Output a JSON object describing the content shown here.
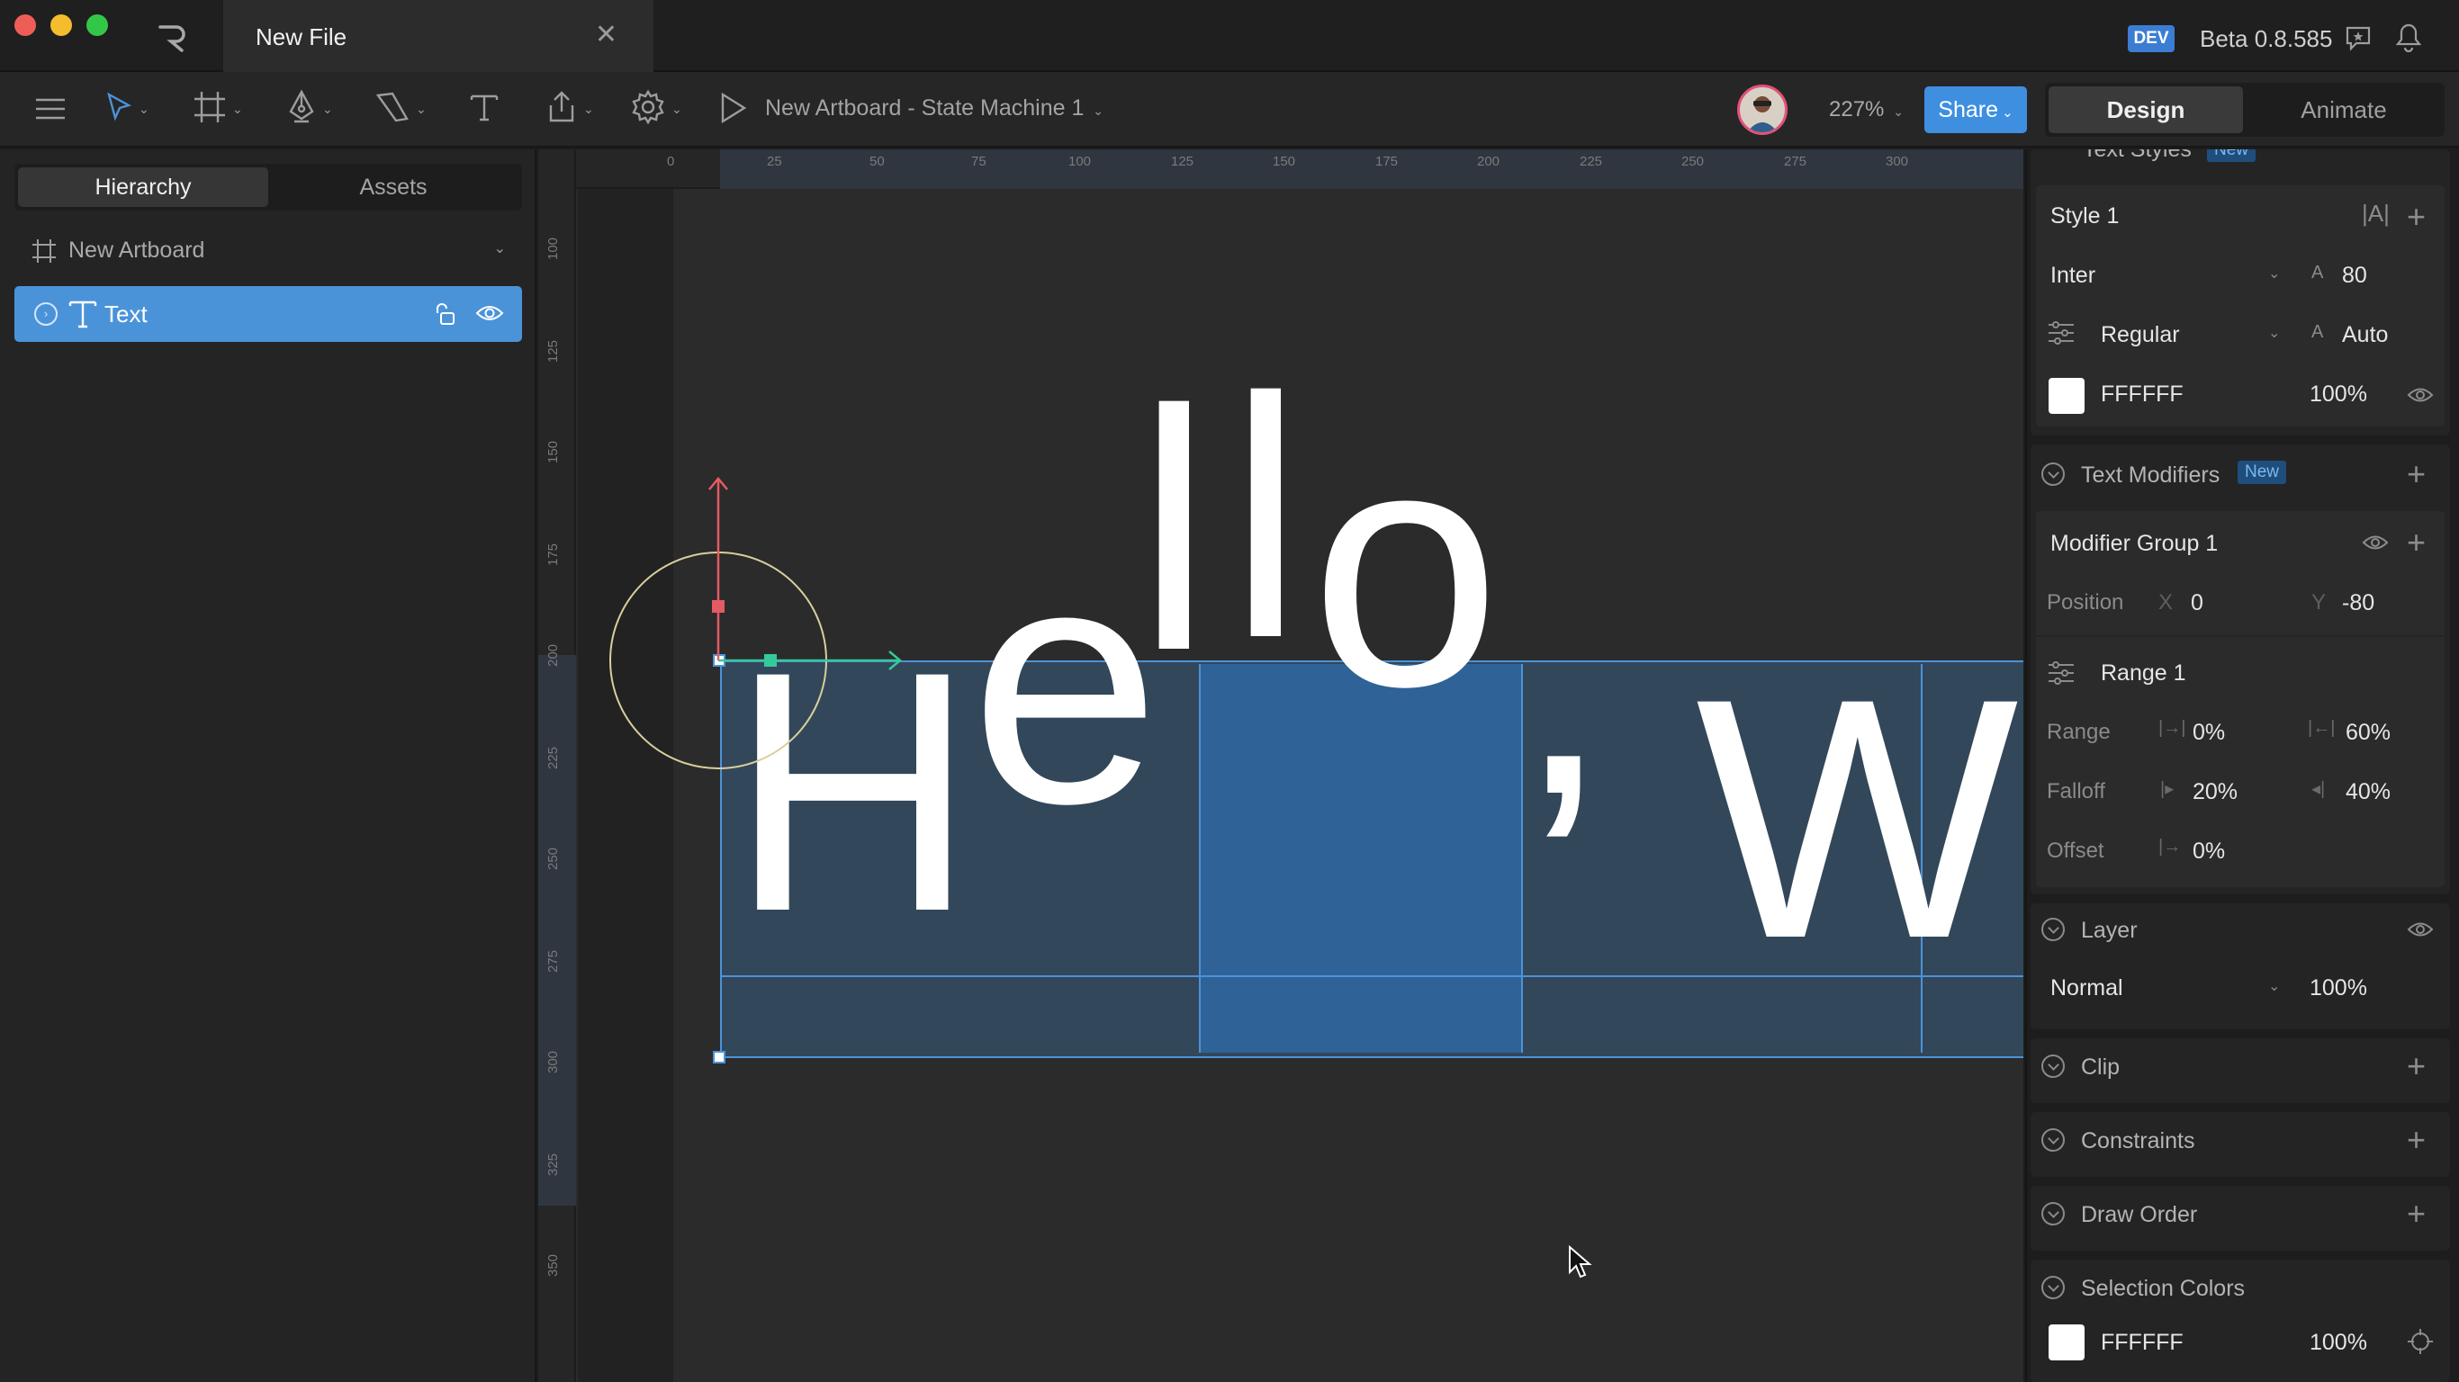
{
  "window": {
    "tab_title": "New File",
    "close_glyph": "✕",
    "dev_badge": "DEV",
    "version": "Beta 0.8.585"
  },
  "toolbar": {
    "artboard_state": "New Artboard - State Machine 1",
    "zoom": "227%",
    "share_label": "Share",
    "design_label": "Design",
    "animate_label": "Animate"
  },
  "left_panel": {
    "tabs": [
      "Hierarchy",
      "Assets"
    ],
    "artboard_label": "New Artboard",
    "text_layer_label": "Text"
  },
  "rulers": {
    "top": [
      "0",
      "25",
      "50",
      "75",
      "100",
      "125",
      "150",
      "175",
      "200",
      "225",
      "250",
      "275",
      "300"
    ],
    "left": [
      "100",
      "125",
      "150",
      "175",
      "200",
      "225",
      "250",
      "275",
      "300",
      "325",
      "350"
    ]
  },
  "canvas": {
    "text_chars": [
      "H",
      "e",
      "l",
      "l",
      "o",
      ",",
      "W"
    ]
  },
  "right_panel": {
    "text_styles_header": "Text Styles",
    "new_badge": "New",
    "style": {
      "name": "Style 1",
      "font": "Inter",
      "size": "80",
      "weight": "Regular",
      "line_height": "Auto",
      "color_hex": "FFFFFF",
      "opacity": "100%"
    },
    "modifiers": {
      "header": "Text Modifiers",
      "badge": "New",
      "group_name": "Modifier Group 1",
      "position_label": "Position",
      "x_label": "X",
      "x_value": "0",
      "y_label": "Y",
      "y_value": "-80",
      "range_name": "Range 1",
      "range_label": "Range",
      "range_start": "0%",
      "range_end": "60%",
      "falloff_label": "Falloff",
      "falloff_start": "20%",
      "falloff_end": "40%",
      "offset_label": "Offset",
      "offset_value": "0%"
    },
    "layer": {
      "header": "Layer",
      "blend": "Normal",
      "opacity": "100%"
    },
    "sections": {
      "clip": "Clip",
      "constraints": "Constraints",
      "draw_order": "Draw Order",
      "selection_colors": "Selection Colors"
    },
    "selection_color": {
      "hex": "FFFFFF",
      "opacity": "100%"
    }
  },
  "colors": {
    "accent": "#4b93d9",
    "selection_fill": "#33475a",
    "highlight_fill": "#2f6296",
    "gizmo_red": "#e25c63",
    "gizmo_green": "#35c99a",
    "gizmo_circle": "#d9cf9c"
  }
}
